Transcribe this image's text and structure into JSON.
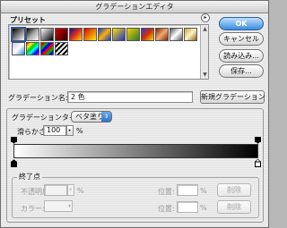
{
  "window": {
    "title": "グラデーションエディタ"
  },
  "presets": {
    "label": "プリセット",
    "swatches": [
      {
        "gradient": "linear-gradient(135deg,#000,#fff)"
      },
      {
        "gradient": "linear-gradient(135deg,#000,#aaa 50%,rgba(255,255,255,0))"
      },
      {
        "gradient": "linear-gradient(135deg,#fff,#000)"
      },
      {
        "gradient": "linear-gradient(135deg,#c00,#300)"
      },
      {
        "gradient": "linear-gradient(135deg,#1a0a8a,#e0301e,#ffd000)"
      },
      {
        "gradient": "linear-gradient(135deg,#d80000,#ffef00)"
      },
      {
        "gradient": "linear-gradient(135deg,#0a3fd8,#ffb000,#0a3fd8)"
      },
      {
        "gradient": "linear-gradient(135deg,#ffe000,#1e2fd0)"
      },
      {
        "gradient": "linear-gradient(135deg,#f7d000,#2c7a2c)"
      },
      {
        "gradient": "linear-gradient(135deg,#4a2ad6,#c30,#ffd600)"
      },
      {
        "gradient": "linear-gradient(135deg,#7b2a00,#f2a774,#7b2a00)"
      },
      {
        "gradient": "linear-gradient(135deg,#555,#fff,#555)"
      },
      {
        "gradient": "linear-gradient(135deg,#c9a23c,#fff3c4,#8a5e10)"
      },
      {
        "gradient": "linear-gradient(135deg,#c4c4ff,#ffffff,#2b86d6)"
      },
      {
        "gradient": "linear-gradient(135deg,#e00,#ff0,#0c0,#0ff,#00f,#f0f)"
      },
      {
        "gradient": "repeating-linear-gradient(135deg,#f00 0 3px,#0a0 3px 6px,#00f 6px 9px)"
      },
      {
        "gradient": "repeating-linear-gradient(135deg,#fff 0 2px,#000 2px 4px)"
      }
    ]
  },
  "buttons": {
    "ok": "OK",
    "cancel": "キャンセル",
    "load": "読み込み...",
    "save": "保存...",
    "new_gradient": "新規グラデーション"
  },
  "name": {
    "label": "グラデーション名:",
    "value": "2 色"
  },
  "gradient_type": {
    "label": "グラデーションタイプ:",
    "value": "ベタ塗り"
  },
  "smoothness": {
    "label": "滑らかさ:",
    "value": "100",
    "unit": "%"
  },
  "stops": {
    "group_label": "終了点",
    "opacity_label": "不透明度:",
    "opacity_unit": "%",
    "color_label": "カラー:",
    "position_label": "位置:",
    "position_unit": "%",
    "delete_label": "削除"
  },
  "colors": {
    "ok_blue": "#3d8bdb",
    "gradient_start": "#ffffff",
    "gradient_end": "#000000"
  }
}
